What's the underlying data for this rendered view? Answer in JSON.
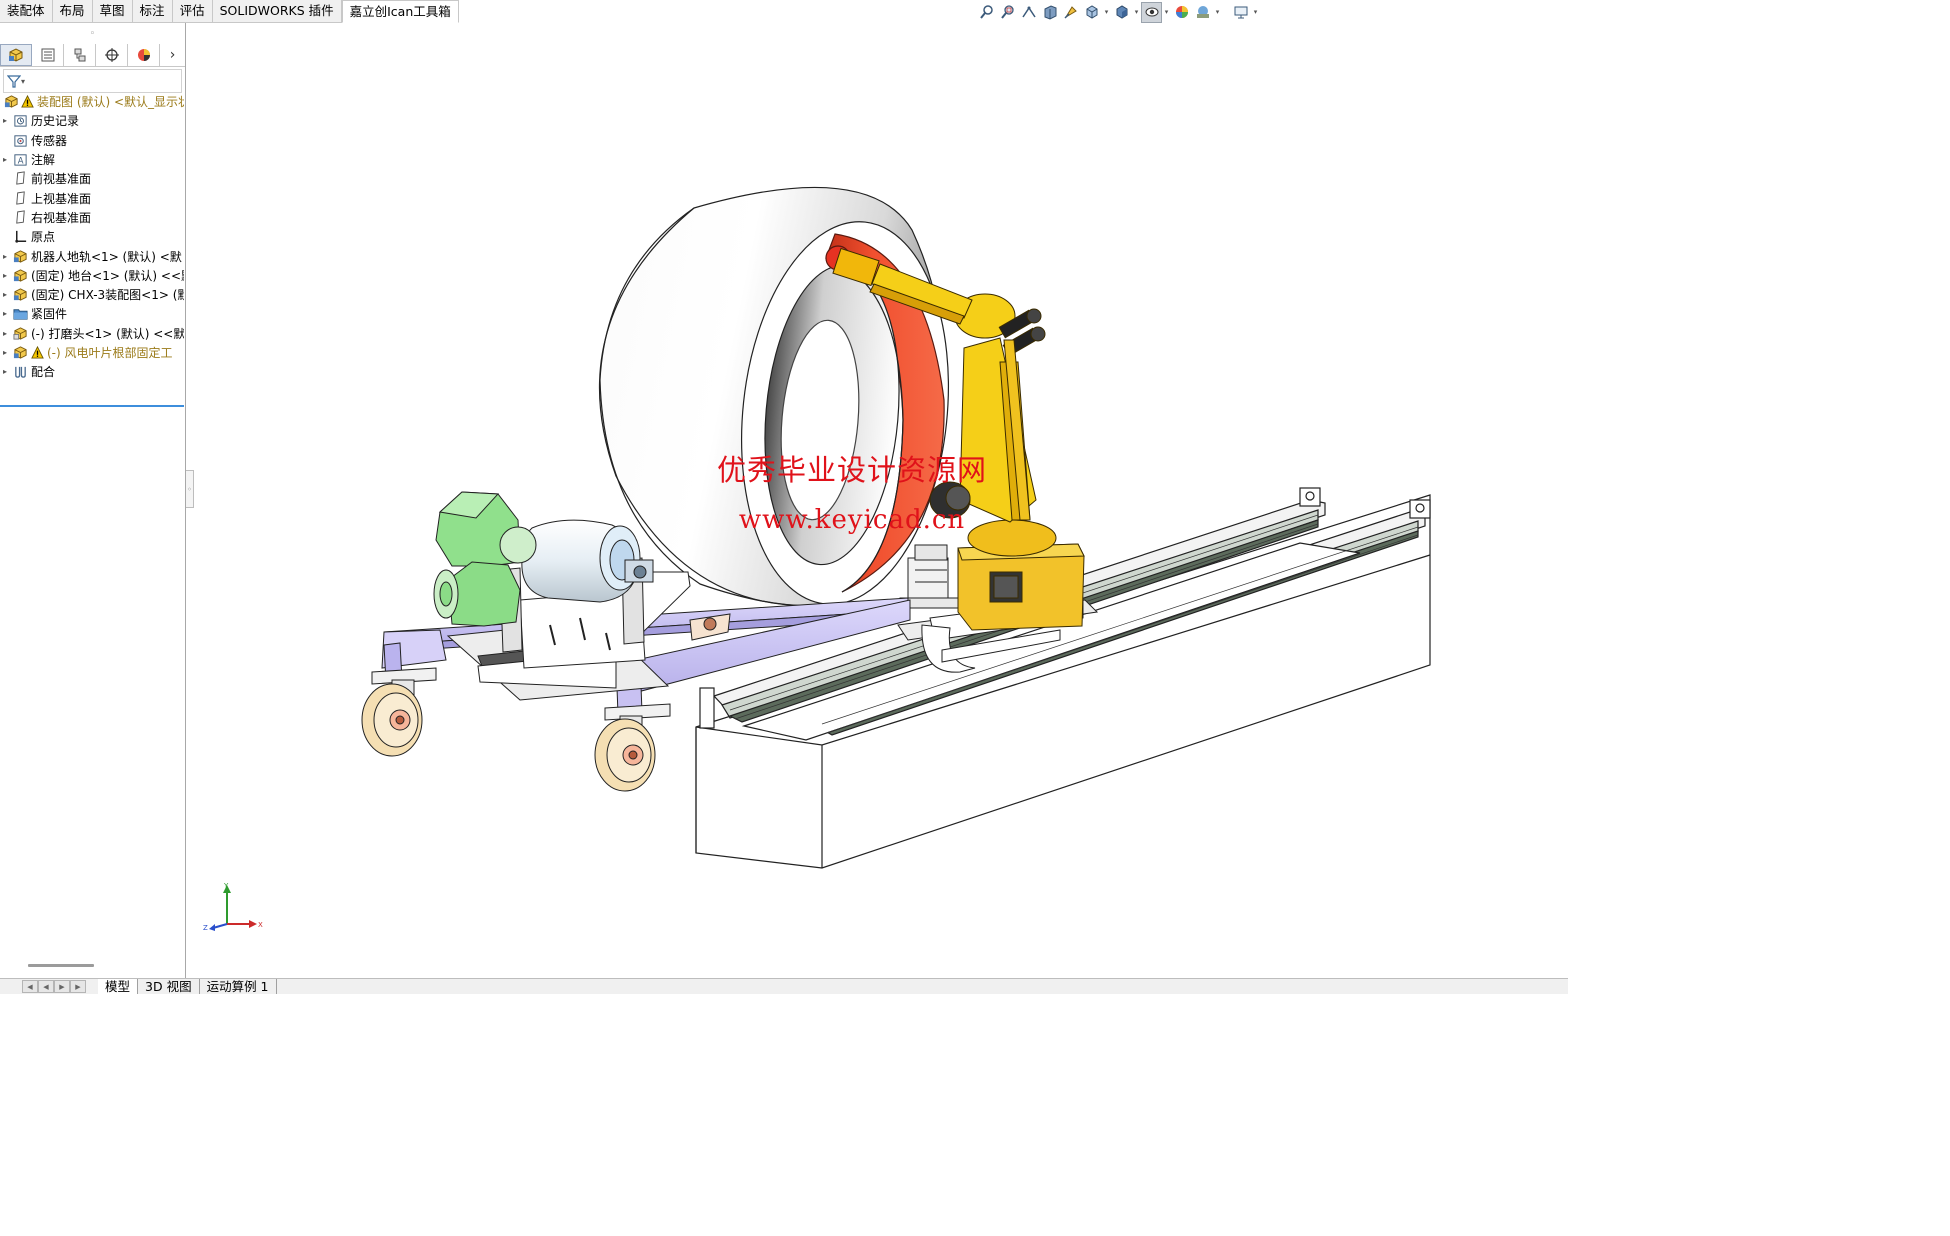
{
  "command_tabs": [
    {
      "label": "装配体",
      "active": false
    },
    {
      "label": "布局",
      "active": false
    },
    {
      "label": "草图",
      "active": false
    },
    {
      "label": "标注",
      "active": false
    },
    {
      "label": "评估",
      "active": false
    },
    {
      "label": "SOLIDWORKS 插件",
      "active": false
    },
    {
      "label": "嘉立创Ican工具箱",
      "active": true
    }
  ],
  "view_toolbar": {
    "icons": [
      "zoom-to-fit-icon",
      "zoom-to-area-icon",
      "previous-view-icon",
      "section-view-icon",
      "dynamic-annotation-icon",
      "view-orientation-icon",
      "display-style-icon",
      "hide-show-items-icon",
      "edit-appearance-icon",
      "apply-scene-icon",
      "view-settings-icon"
    ]
  },
  "panel": {
    "tabs": [
      "featuremanager-tab",
      "propertymanager-tab",
      "configurationmanager-tab",
      "dimxpert-tab",
      "displaymanager-tab"
    ],
    "more_glyph": "›",
    "filter_glyph": "▾"
  },
  "tree": {
    "root_label": "装配图 (默认) <默认_显示状",
    "items": [
      {
        "label": "历史记录",
        "icon": "history-icon",
        "expandable": true,
        "warn": false
      },
      {
        "label": "传感器",
        "icon": "sensor-icon",
        "expandable": false,
        "warn": false
      },
      {
        "label": "注解",
        "icon": "annotation-icon",
        "expandable": true,
        "warn": false
      },
      {
        "label": "前视基准面",
        "icon": "plane-icon",
        "expandable": false,
        "warn": false
      },
      {
        "label": "上视基准面",
        "icon": "plane-icon",
        "expandable": false,
        "warn": false
      },
      {
        "label": "右视基准面",
        "icon": "plane-icon",
        "expandable": false,
        "warn": false
      },
      {
        "label": "原点",
        "icon": "origin-icon",
        "expandable": false,
        "warn": false
      },
      {
        "label": "机器人地轨<1> (默认) <默",
        "icon": "subassembly-icon",
        "expandable": true,
        "warn": false
      },
      {
        "label": "(固定) 地台<1> (默认) <<默",
        "icon": "subassembly-icon",
        "expandable": true,
        "warn": false
      },
      {
        "label": "(固定) CHX-3装配图<1> (默",
        "icon": "subassembly-icon",
        "expandable": true,
        "warn": false
      },
      {
        "label": "紧固件",
        "icon": "folder-icon",
        "expandable": true,
        "warn": false
      },
      {
        "label": "(-) 打磨头<1> (默认) <<默",
        "icon": "subassembly-icon",
        "expandable": true,
        "warn": false
      },
      {
        "label": "(-) 风电叶片根部固定工",
        "icon": "subassembly-icon",
        "expandable": true,
        "warn": true
      },
      {
        "label": "配合",
        "icon": "mates-icon",
        "expandable": true,
        "warn": false
      }
    ]
  },
  "watermark": {
    "line1": "优秀毕业设计资源网",
    "line2": "www.keyicad.cn"
  },
  "triad": {
    "x": "X",
    "y": "Y",
    "z": "Z"
  },
  "bottom_tabs": [
    {
      "label": "模型",
      "active": true
    },
    {
      "label": "3D 视图",
      "active": false
    },
    {
      "label": "运动算例 1",
      "active": false
    }
  ],
  "colors": {
    "accent": "#3d8edc",
    "robot_yellow": "#f5cf18",
    "drum_red": "#ee4428",
    "gear_green": "#8fe08a",
    "frame_lavender": "#cdc7f3",
    "wheel_cream": "#f4ddb0",
    "watermark": "#e0121a"
  }
}
